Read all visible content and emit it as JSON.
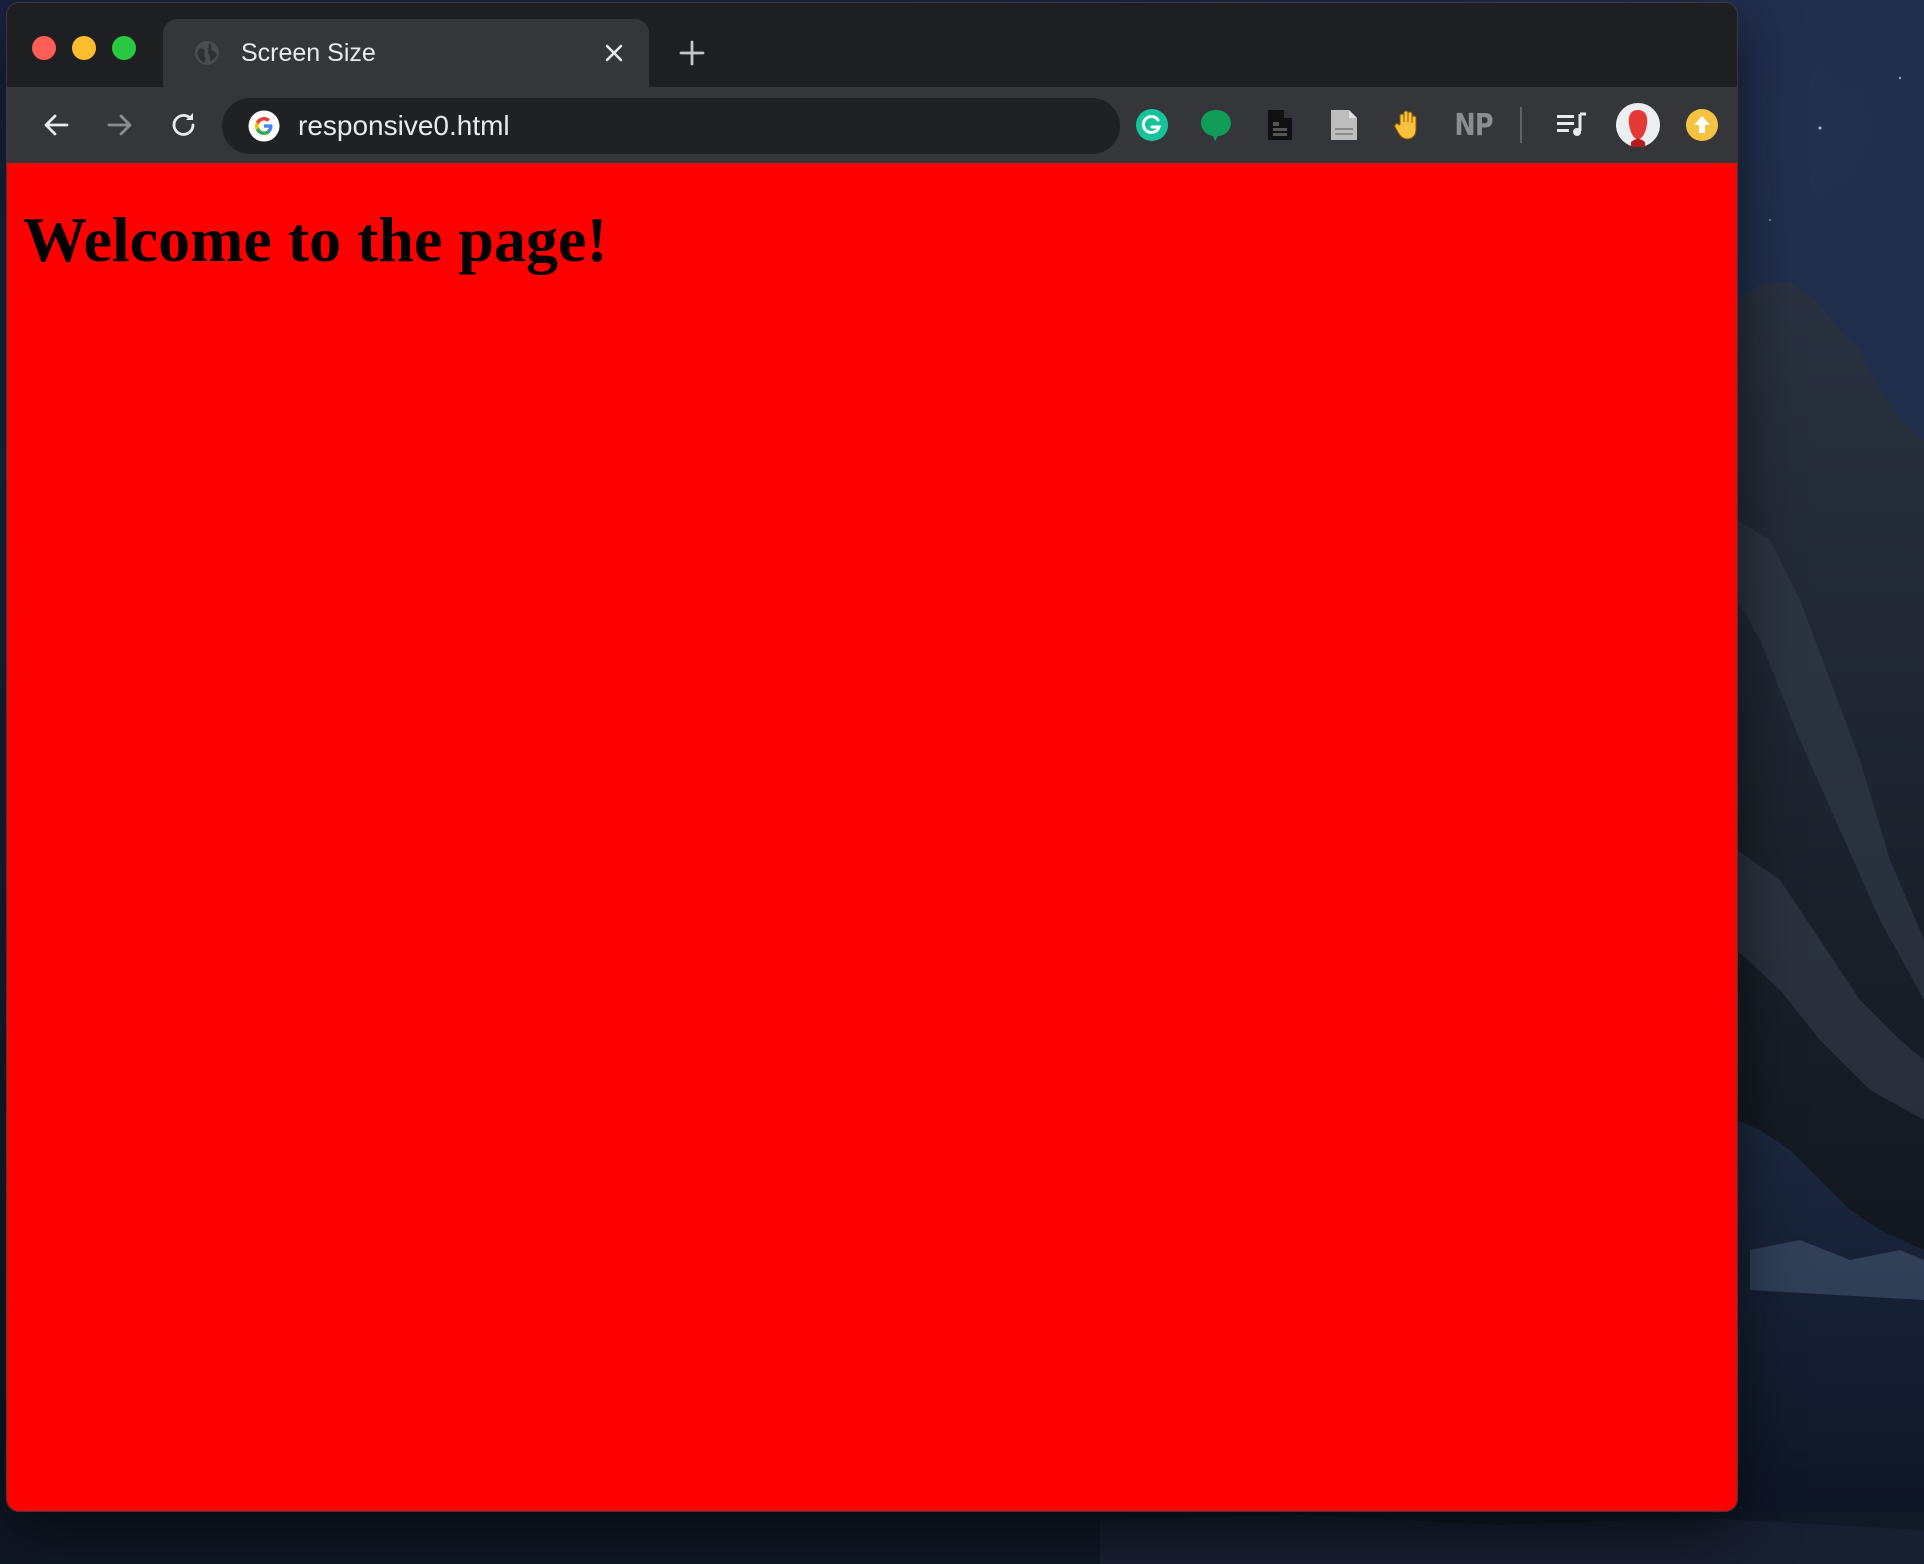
{
  "browser": {
    "tab": {
      "title": "Screen Size"
    },
    "omnibox": {
      "url": "responsive0.html"
    },
    "extensions": [
      {
        "name": "grammarly-icon",
        "color": "#15c39a"
      },
      {
        "name": "speech-bubble-icon",
        "color": "#0f9d58"
      },
      {
        "name": "document-icon",
        "color": "#111111"
      },
      {
        "name": "page-icon",
        "color": "#bdbdbd"
      },
      {
        "name": "hand-wave-icon",
        "color": "#f9c23c"
      },
      {
        "name": "np-text",
        "label": "NP"
      },
      {
        "name": "playlist-icon",
        "color": "#e8eaed"
      },
      {
        "name": "avatar",
        "color": "#e53935"
      },
      {
        "name": "update-icon",
        "color": "#f5c242"
      }
    ]
  },
  "page": {
    "heading": "Welcome to the page!",
    "background_color": "#ff0000"
  },
  "colors": {
    "window_close": "#fd5f57",
    "window_minimize": "#febc2e",
    "window_maximize": "#28c840",
    "tab_bg": "#35363a",
    "titlebar_bg": "#1e1f21"
  }
}
